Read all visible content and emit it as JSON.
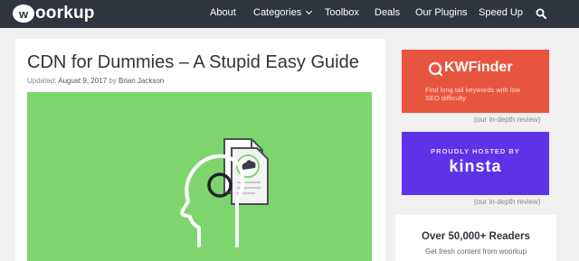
{
  "header": {
    "logo_mark": "w",
    "logo_text": "oorkup",
    "nav": {
      "about": "About",
      "categories": "Categories",
      "toolbox": "Toolbox",
      "deals": "Deals",
      "plugins": "Our Plugins",
      "speed": "Speed Up"
    }
  },
  "article": {
    "title": "CDN for Dummies – A Stupid Easy Guide",
    "updated_label": "Updated:",
    "date": "August 9, 2017",
    "by": "by",
    "author": "Brian Jackson"
  },
  "sidebar": {
    "kwfinder": {
      "name": "KWFinder",
      "tagline": "Find long tail keywords with low SEO difficulty",
      "review": "(our in-depth review)"
    },
    "kinsta": {
      "top_label": "PROUDLY HOSTED BY",
      "name": "kinsta",
      "review": "(our in-depth review)"
    },
    "readers": {
      "title": "Over 50,000+ Readers",
      "subtitle": "Get fresh content from woorkup"
    }
  },
  "colors": {
    "topbar": "#2f353d",
    "hero": "#7ed56e",
    "kwfinder": "#e8553e",
    "kinsta": "#5e33e8"
  }
}
